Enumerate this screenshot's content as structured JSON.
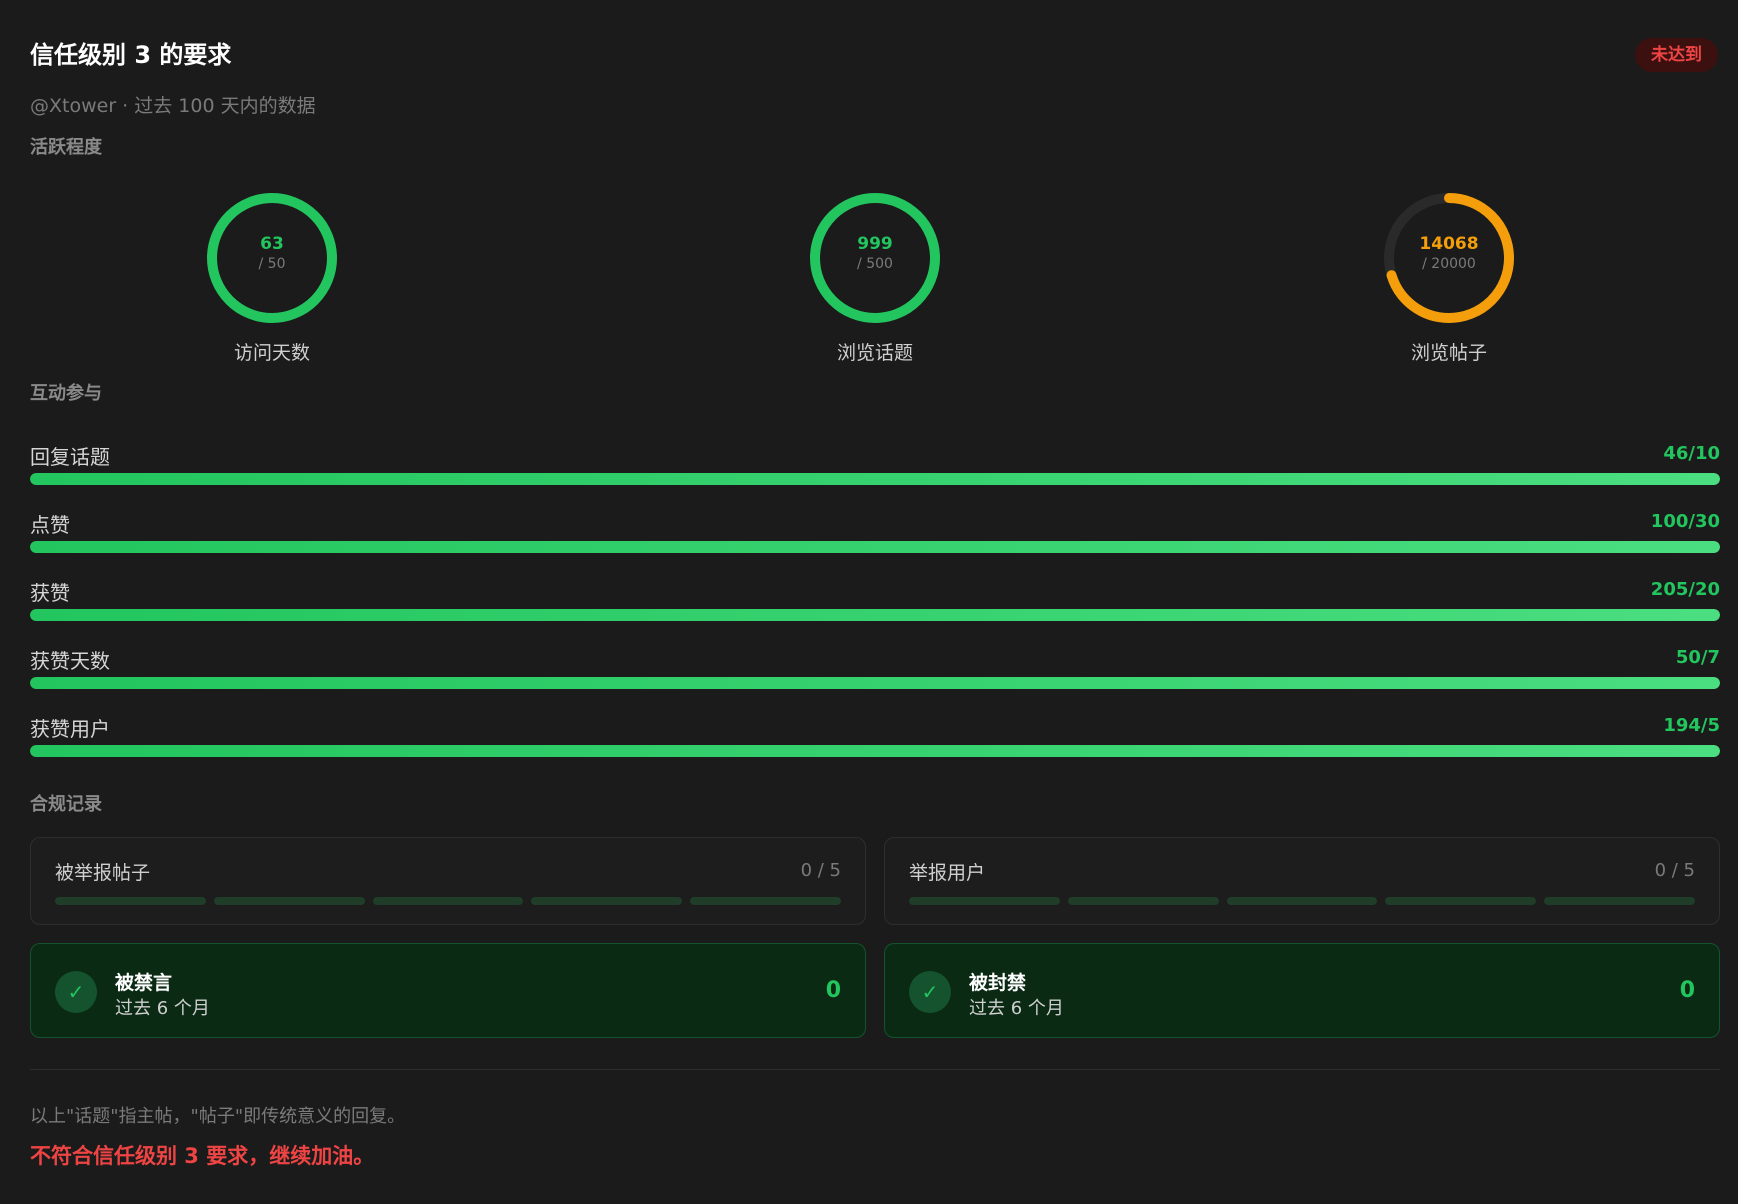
{
  "header": {
    "title": "信任级别 3 的要求",
    "badge": "未达到",
    "subtitle": "@Xtower · 过去 100 天内的数据"
  },
  "colors": {
    "success": "#22c55e",
    "warning": "#f59e0b",
    "danger": "#ef4444",
    "track": "#2a2a2a"
  },
  "activity": {
    "label": "活跃程度",
    "rings": [
      {
        "value": "63",
        "target": "/ 50",
        "label": "访问天数",
        "progress": 1.0,
        "color": "#22c55e"
      },
      {
        "value": "999",
        "target": "/ 500",
        "label": "浏览话题",
        "progress": 1.0,
        "color": "#22c55e"
      },
      {
        "value": "14068",
        "target": "/ 20000",
        "label": "浏览帖子",
        "progress": 0.7034,
        "color": "#f59e0b"
      }
    ]
  },
  "engagement": {
    "label": "互动参与",
    "bars": [
      {
        "label": "回复话题",
        "value": "46/10",
        "progress": 1.0
      },
      {
        "label": "点赞",
        "value": "100/30",
        "progress": 1.0
      },
      {
        "label": "获赞",
        "value": "205/20",
        "progress": 1.0
      },
      {
        "label": "获赞天数",
        "value": "50/7",
        "progress": 1.0
      },
      {
        "label": "获赞用户",
        "value": "194/5",
        "progress": 1.0
      }
    ]
  },
  "compliance": {
    "label": "合规记录",
    "reports": [
      {
        "label": "被举报帖子",
        "count": "0 / 5",
        "filled": 0,
        "segments": 5
      },
      {
        "label": "举报用户",
        "count": "0 / 5",
        "filled": 0,
        "segments": 5
      }
    ],
    "penalties": [
      {
        "title": "被禁言",
        "sub": "过去 6 个月",
        "value": "0"
      },
      {
        "title": "被封禁",
        "sub": "过去 6 个月",
        "value": "0"
      }
    ]
  },
  "footer": {
    "note": "以上\"话题\"指主帖，\"帖子\"即传统意义的回复。",
    "verdict": "不符合信任级别 3 要求，继续加油。"
  }
}
